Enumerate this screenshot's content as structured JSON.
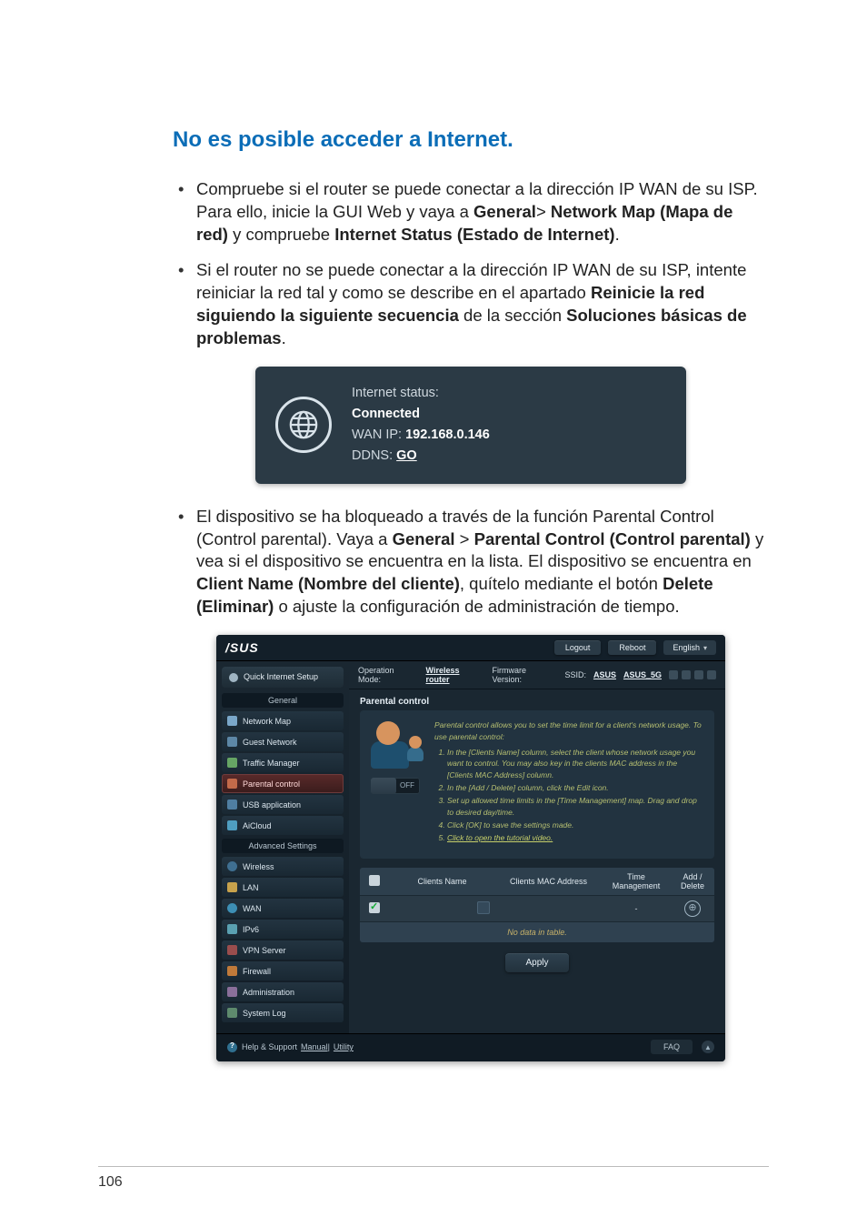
{
  "page_number": "106",
  "heading": "No es posible acceder a Internet.",
  "bullets": [
    {
      "pre": "Compruebe si el router se puede conectar a la dirección IP WAN de su ISP. Para ello, inicie la GUI Web y vaya a ",
      "b1": "General",
      "mid1": "> ",
      "b2": "Network Map (Mapa de red)",
      "mid2": " y compruebe ",
      "b3": "Internet Status (Estado de Internet)",
      "post": "."
    },
    {
      "pre": "Si el router no se puede conectar a la dirección IP WAN de su ISP, intente reiniciar la red tal y como se describe en el apartado ",
      "b1": "Reinicie la red siguiendo la siguiente secuencia",
      "mid1": " de la sección ",
      "b2": "Soluciones básicas de problemas",
      "post": "."
    }
  ],
  "status_panel": {
    "line1": "Internet status:",
    "connected": "Connected",
    "wan_label": "WAN IP: ",
    "wan_ip": "192.168.0.146",
    "ddns_label": "DDNS: ",
    "ddns_value": "GO"
  },
  "bullet3": {
    "pre": "El dispositivo se ha bloqueado a través de la función Parental Control (Control parental). Vaya a ",
    "b1": "General",
    "mid1": " > ",
    "b2": "Parental Control (Control parental)",
    "mid2": " y vea si el dispositivo se encuentra en la lista. El dispositivo se encuentra en ",
    "b3": "Client Name (Nombre del cliente)",
    "mid3": ", quítelo mediante el botón ",
    "b4": "Delete (Eliminar)",
    "post": " o ajuste la configuración de administración de tiempo."
  },
  "router": {
    "brand": "/SUS",
    "logout": "Logout",
    "reboot": "Reboot",
    "language": "English",
    "opmode_label": "Operation Mode: ",
    "opmode_value": "Wireless router",
    "fw_label": "Firmware Version:",
    "ssid_label": "SSID: ",
    "ssid1": "ASUS",
    "ssid2": "ASUS_5G",
    "section": "Parental control",
    "intro": "Parental control allows you to set the time limit for a client's network usage. To use parental control:",
    "steps": [
      "In the [Clients Name] column, select the client whose network usage you want to control. You may also key in the clients MAC address in the [Clients MAC Address] column.",
      "In the [Add / Delete] column, click the Edit icon.",
      "Set up allowed time limits in the [Time Management] map. Drag and drop to desired day/time.",
      "Click [OK] to save the settings made."
    ],
    "tutorial": "Click to open the tutorial video.",
    "toggle_off": "OFF",
    "sidebar": {
      "qis": "Quick Internet Setup",
      "general": "General",
      "items_general": [
        "Network Map",
        "Guest Network",
        "Traffic Manager",
        "Parental control",
        "USB application",
        "AiCloud"
      ],
      "advanced": "Advanced Settings",
      "items_adv": [
        "Wireless",
        "LAN",
        "WAN",
        "IPv6",
        "VPN Server",
        "Firewall",
        "Administration",
        "System Log"
      ]
    },
    "table": {
      "h_clients": "Clients Name",
      "h_mac": "Clients MAC Address",
      "h_time": "Time Management",
      "h_add": "Add / Delete",
      "dash": "-",
      "nodata": "No data in table."
    },
    "apply": "Apply",
    "footer": {
      "help": "Help & Support",
      "manual": "Manual",
      "sep": " | ",
      "utility": "Utility",
      "faq": "FAQ"
    }
  }
}
